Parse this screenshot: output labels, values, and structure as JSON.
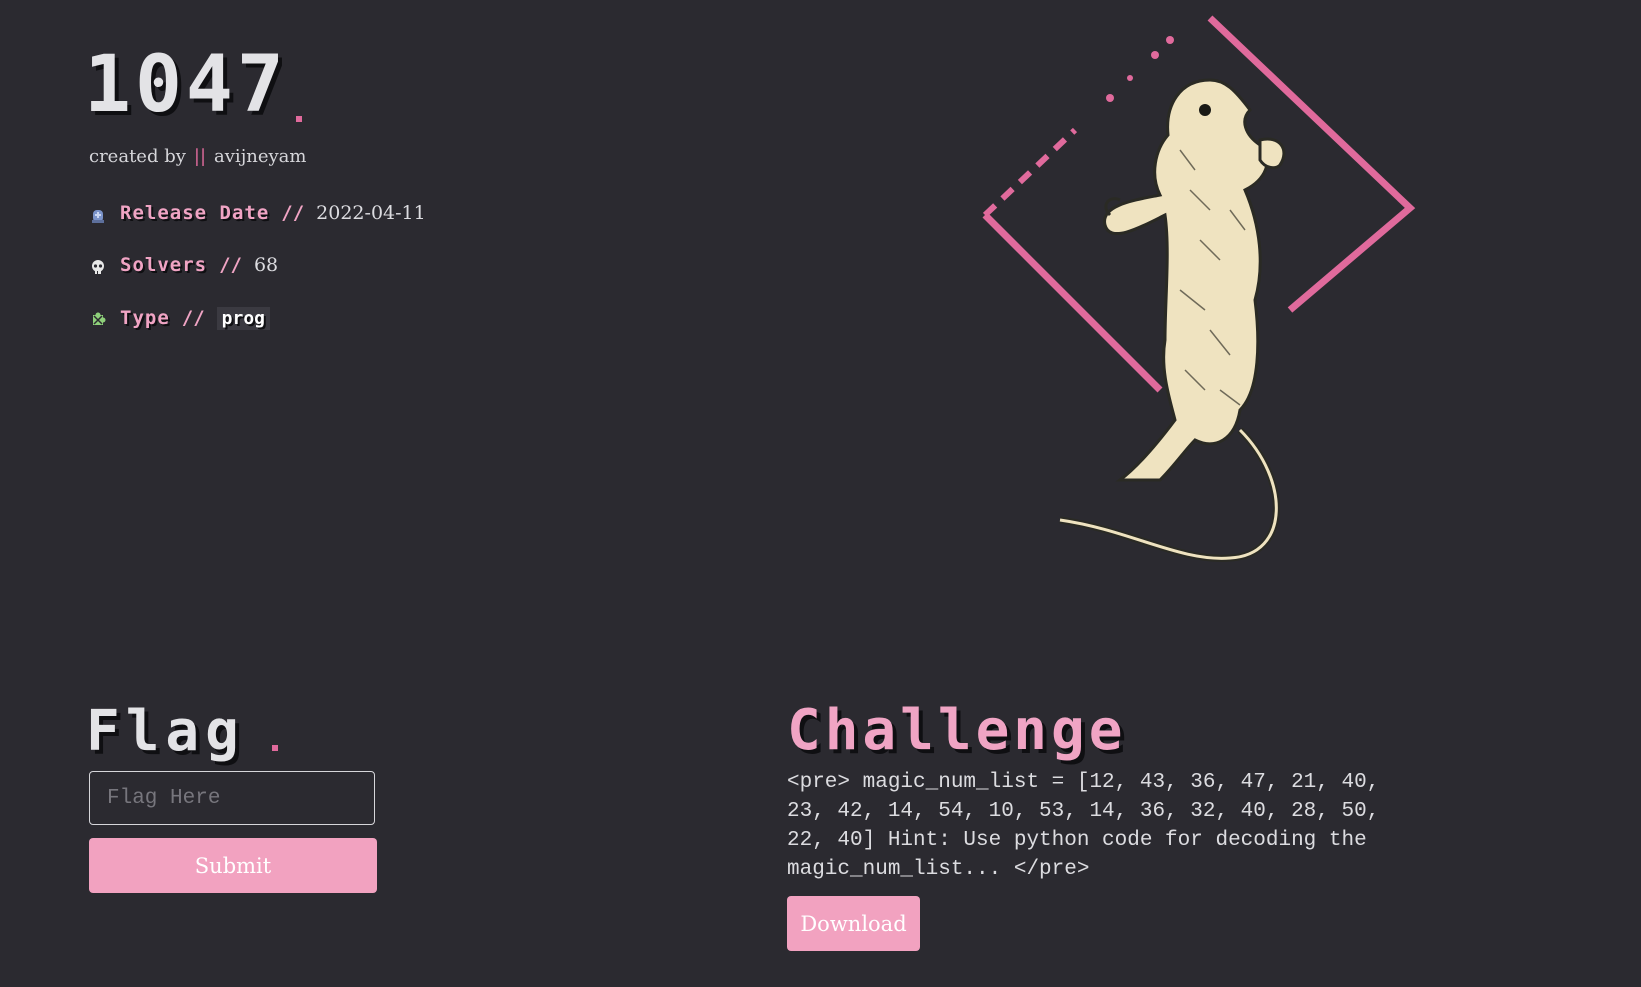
{
  "header": {
    "title": "1047",
    "created_by_prefix": "created by",
    "separator": "||",
    "author": "avijneyam"
  },
  "meta": {
    "release": {
      "label": "Release Date",
      "sep": "//",
      "value": "2022-04-11",
      "icon": "tombstone-icon"
    },
    "solvers": {
      "label": "Solvers",
      "sep": "//",
      "value": "68",
      "icon": "skull-icon"
    },
    "type": {
      "label": "Type",
      "sep": "//",
      "value": "prog",
      "icon": "puzzle-icon"
    }
  },
  "flag": {
    "title": "Flag",
    "placeholder": "Flag Here",
    "submit_label": "Submit"
  },
  "challenge": {
    "title": "Challenge",
    "description": "<pre> magic_num_list = [12, 43, 36, 47, 21, 40, 23, 42, 14, 54, 10, 53, 14, 36, 32, 40, 28, 50, 22, 40] Hint: Use python code for decoding the magic_num_list... </pre>",
    "download_label": "Download"
  },
  "colors": {
    "background": "#2b2a30",
    "accent_pink": "#f0a4c4",
    "diamond_pink": "#e06a9c",
    "button_pink": "#f2a2c0"
  },
  "illustration": {
    "icon": "rat-in-diamond-illustration"
  }
}
